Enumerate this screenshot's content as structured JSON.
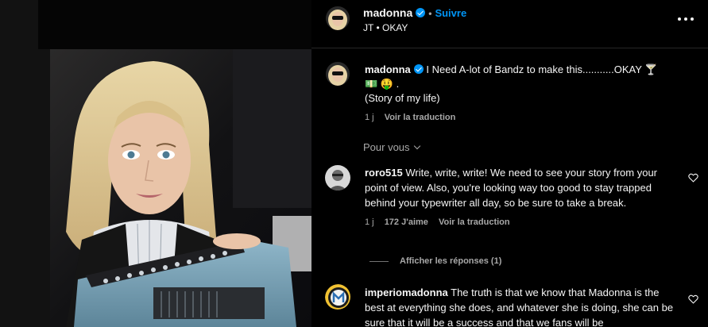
{
  "header": {
    "username": "madonna",
    "follow_label": "Suivre",
    "audio_label": "JT • OKAY"
  },
  "caption": {
    "username": "madonna",
    "line1": "I Need A-lot of Bandz to make this...........OKAY 🍸",
    "line2_emojis": "💵 🤑 .",
    "line3": "(Story of my life)",
    "time": "1 j",
    "translate_label": "Voir la traduction"
  },
  "for_you_label": "Pour vous",
  "comments": [
    {
      "username": "roro515",
      "text": "Write, write, write! We need to see your story from your point of view. Also, you're looking way too good to stay trapped behind your typewriter all day, so be sure to take a break.",
      "time": "1 j",
      "likes": "172 J'aime",
      "translate_label": "Voir la traduction",
      "replies_label": "Afficher les réponses (1)"
    },
    {
      "username": "imperiomadonna",
      "text": "The truth is that we know that Madonna is the best at everything she does, and whatever she is doing, she can be sure that it will be a success and that we fans will be"
    }
  ],
  "icons": {
    "verified": "verified-badge-icon",
    "more": "more-options-icon",
    "heart": "heart-outline-icon",
    "chevron": "chevron-down-icon"
  },
  "colors": {
    "accent": "#0095f6",
    "muted": "#a8a8a8",
    "background": "#000000"
  }
}
